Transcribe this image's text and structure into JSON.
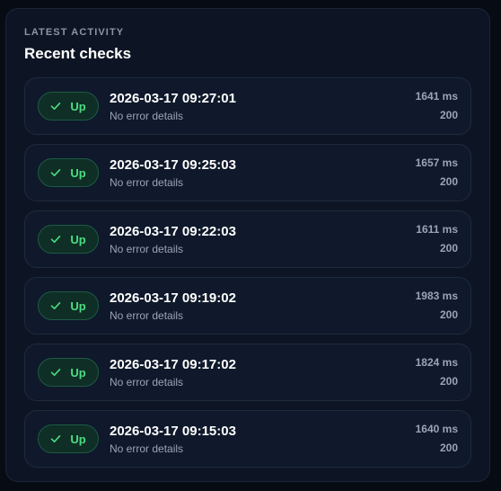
{
  "header": {
    "eyebrow": "LATEST ACTIVITY",
    "title": "Recent checks"
  },
  "colors": {
    "up_accent": "#4ade80",
    "panel_bg": "#0d1524"
  },
  "checks": [
    {
      "status": "Up",
      "status_icon": "check-icon",
      "timestamp": "2026-03-17 09:27:01",
      "error": "No error details",
      "duration": "1641 ms",
      "http_code": "200"
    },
    {
      "status": "Up",
      "status_icon": "check-icon",
      "timestamp": "2026-03-17 09:25:03",
      "error": "No error details",
      "duration": "1657 ms",
      "http_code": "200"
    },
    {
      "status": "Up",
      "status_icon": "check-icon",
      "timestamp": "2026-03-17 09:22:03",
      "error": "No error details",
      "duration": "1611 ms",
      "http_code": "200"
    },
    {
      "status": "Up",
      "status_icon": "check-icon",
      "timestamp": "2026-03-17 09:19:02",
      "error": "No error details",
      "duration": "1983 ms",
      "http_code": "200"
    },
    {
      "status": "Up",
      "status_icon": "check-icon",
      "timestamp": "2026-03-17 09:17:02",
      "error": "No error details",
      "duration": "1824 ms",
      "http_code": "200"
    },
    {
      "status": "Up",
      "status_icon": "check-icon",
      "timestamp": "2026-03-17 09:15:03",
      "error": "No error details",
      "duration": "1640 ms",
      "http_code": "200"
    }
  ]
}
